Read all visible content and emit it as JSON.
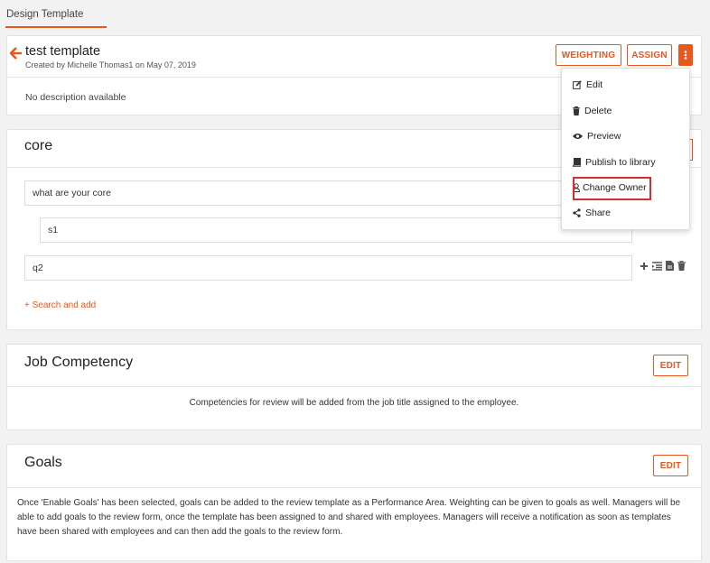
{
  "tab": {
    "label": "Design Template"
  },
  "header": {
    "title": "test template",
    "subtitle": "Created by Michelle Thomas1 on May 07, 2019",
    "description": "No description available",
    "weighting_label": "WEIGHTING",
    "assign_label": "ASSIGN"
  },
  "menu": {
    "items": [
      {
        "label": "Edit",
        "icon": "edit-icon"
      },
      {
        "label": "Delete",
        "icon": "trash-icon"
      },
      {
        "label": "Preview",
        "icon": "eye-icon"
      },
      {
        "label": "Publish to library",
        "icon": "book-icon"
      },
      {
        "label": "Change Owner",
        "icon": "user-icon"
      },
      {
        "label": "Share",
        "icon": "share-icon"
      }
    ]
  },
  "core": {
    "title": "core",
    "question1": "what are your core",
    "sub1": "s1",
    "question2": "q2",
    "search_add": "+ Search and add"
  },
  "job": {
    "title": "Job Competency",
    "edit_label": "EDIT",
    "text": "Competencies for review will be added from the job title assigned to the employee."
  },
  "goals": {
    "title": "Goals",
    "edit_label": "EDIT",
    "text": "Once 'Enable Goals' has been selected, goals can be added to the review template as a Performance Area. Weighting can be given to goals as well. Managers will be able to add goals to the review form, once the template has been assigned to and shared with employees. Managers will receive a notification as soon as templates have been shared with employees and can then add the goals to the review form."
  },
  "colors": {
    "accent": "#e8571e",
    "highlight": "#d32f2f"
  }
}
